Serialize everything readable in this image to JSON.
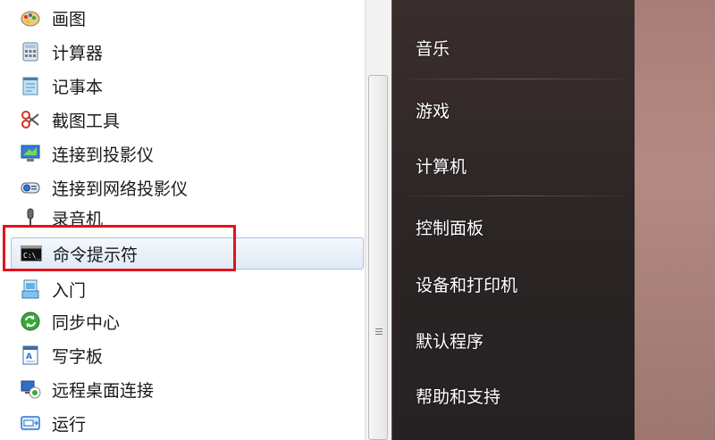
{
  "programs": [
    {
      "label": "画图",
      "icon": "paint-icon"
    },
    {
      "label": "计算器",
      "icon": "calculator-icon"
    },
    {
      "label": "记事本",
      "icon": "notepad-icon"
    },
    {
      "label": "截图工具",
      "icon": "scissors-icon"
    },
    {
      "label": "连接到投影仪",
      "icon": "projector-icon"
    },
    {
      "label": "连接到网络投影仪",
      "icon": "network-projector-icon"
    },
    {
      "label": "录音机",
      "icon": "microphone-icon"
    },
    {
      "label": "命令提示符",
      "icon": "command-prompt-icon"
    },
    {
      "label": "入门",
      "icon": "getting-started-icon"
    },
    {
      "label": "同步中心",
      "icon": "sync-icon"
    },
    {
      "label": "写字板",
      "icon": "wordpad-icon"
    },
    {
      "label": "远程桌面连接",
      "icon": "remote-desktop-icon"
    },
    {
      "label": "运行",
      "icon": "run-icon"
    }
  ],
  "right_menu": [
    {
      "label": "音乐"
    },
    {
      "label": "游戏"
    },
    {
      "label": "计算机"
    },
    {
      "label": "控制面板"
    },
    {
      "label": "设备和打印机"
    },
    {
      "label": "默认程序"
    },
    {
      "label": "帮助和支持"
    }
  ],
  "colors": {
    "highlight_border": "#e3131b",
    "selected_bg": "#dfe9f6",
    "menu_text": "#ffffff"
  },
  "cmd_icon_text": "C:\\_"
}
